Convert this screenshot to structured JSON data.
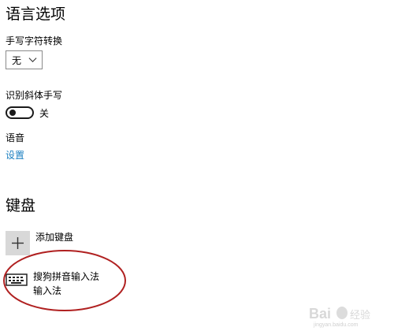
{
  "language_options": {
    "title": "语言选项"
  },
  "handwriting": {
    "label": "手写字符转换",
    "dropdown_value": "无"
  },
  "italic": {
    "label": "识别斜体手写",
    "toggle_state": "关",
    "toggle_on": false
  },
  "speech": {
    "label": "语音",
    "settings_link": "设置"
  },
  "keyboard": {
    "title": "键盘",
    "add_label": "添加键盘",
    "items": [
      {
        "name": "搜狗拼音输入法",
        "subtitle": "输入法"
      }
    ]
  },
  "watermark": {
    "text": "Baidu 经验",
    "subtext": "jingyan.baidu.com"
  },
  "colors": {
    "link": "#1a7fc0",
    "annotation": "#b02020",
    "add_tile": "#d8d8d8"
  },
  "icons": [
    "chevron-down-icon",
    "plus-icon",
    "keyboard-icon"
  ]
}
